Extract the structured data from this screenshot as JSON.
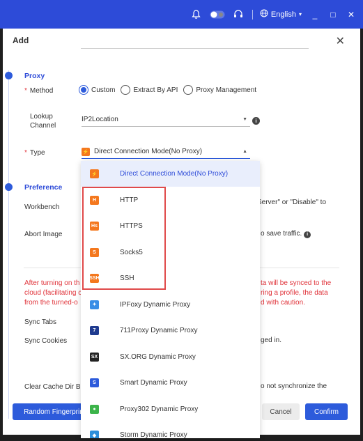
{
  "titlebar": {
    "language": "English"
  },
  "dialog": {
    "title": "Add",
    "proxy_section": "Proxy",
    "method_label": "Method",
    "method_options": [
      "Custom",
      "Extract By API",
      "Proxy Management"
    ],
    "method_selected": "Custom",
    "lookup_label_1": "Lookup",
    "lookup_label_2": "Channel",
    "lookup_value": "IP2Location",
    "type_label": "Type",
    "type_value": "Direct Connection Mode(No Proxy)",
    "preference_section": "Preference",
    "workbench_label": "Workbench",
    "workbench_text_partial": "Server\" or \"Disable\" to",
    "abort_image_label": "Abort Image",
    "abort_image_text_partial": "o save traffic.",
    "warning_lines": [
      [
        "After turning on th",
        "ta will be synced to the"
      ],
      [
        "cloud (facilitating c",
        "ring a profile, the data"
      ],
      [
        "from the turned-o",
        "d with caution."
      ]
    ],
    "sync_tabs_label": "Sync Tabs",
    "sync_cookies_label": "Sync Cookies",
    "sync_cookies_text_partial": "ged in.",
    "clear_cache_label": "Clear Cache Dir Be",
    "clear_cache_text_partial": "o not synchronize the",
    "random_button": "Random Fingerprin",
    "cancel_button": "Cancel",
    "confirm_button": "Confirm"
  },
  "dropdown": {
    "items": [
      {
        "label": "Direct Connection Mode(No Proxy)",
        "icon": "direct-icon",
        "glyph": "⚡",
        "color": "#f4781e"
      },
      {
        "label": "HTTP",
        "icon": "http-icon",
        "glyph": "H",
        "color": "#f4781e"
      },
      {
        "label": "HTTPS",
        "icon": "https-icon",
        "glyph": "Hs",
        "color": "#f4781e"
      },
      {
        "label": "Socks5",
        "icon": "socks5-icon",
        "glyph": "S",
        "color": "#f4781e"
      },
      {
        "label": "SSH",
        "icon": "ssh-icon",
        "glyph": "SSH",
        "color": "#f4781e"
      },
      {
        "label": "IPFoxy Dynamic Proxy",
        "icon": "ipfoxy-icon",
        "glyph": "✦",
        "color": "#3a8ee6"
      },
      {
        "label": "711Proxy Dynamic Proxy",
        "icon": "711proxy-icon",
        "glyph": "7",
        "color": "#1f3b8f"
      },
      {
        "label": "SX.ORG Dynamic Proxy",
        "icon": "sxorg-icon",
        "glyph": "SX",
        "color": "#222222"
      },
      {
        "label": "Smart Dynamic Proxy",
        "icon": "smart-icon",
        "glyph": "S",
        "color": "#2d5bdb"
      },
      {
        "label": "Proxy302 Dynamic Proxy",
        "icon": "proxy302-icon",
        "glyph": "●",
        "color": "#3cb44a"
      },
      {
        "label": "Storm Dynamic Proxy",
        "icon": "storm-icon",
        "glyph": "◆",
        "color": "#2d8fdb"
      }
    ],
    "selected_index": 0
  }
}
